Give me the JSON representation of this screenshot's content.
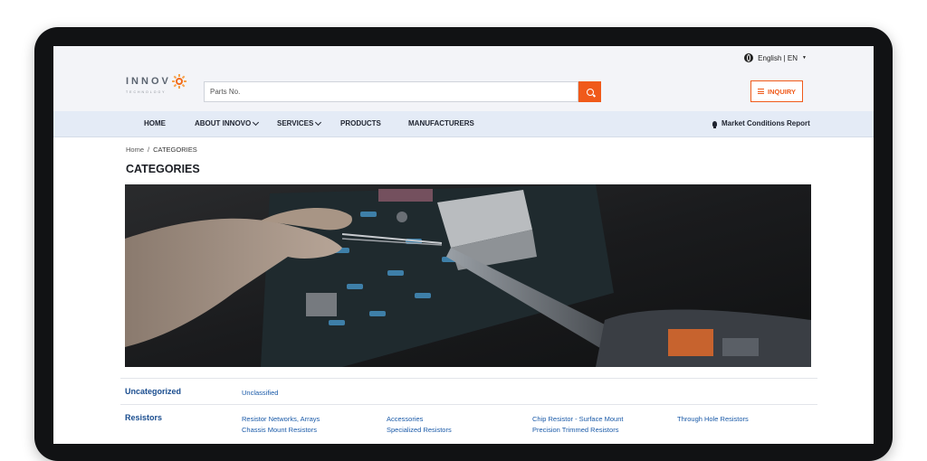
{
  "header": {
    "language_label": "English | EN",
    "logo_text": "INNOV",
    "logo_subtext": "TECHNOLOGY",
    "search_placeholder": "Parts No.",
    "inquiry_label": "INQUIRY"
  },
  "nav": {
    "items": [
      {
        "label": "HOME",
        "dropdown": false
      },
      {
        "label": "ABOUT INNOVO",
        "dropdown": true
      },
      {
        "label": "SERVICES",
        "dropdown": true
      },
      {
        "label": "PRODUCTS",
        "dropdown": false
      },
      {
        "label": "MANUFACTURERS",
        "dropdown": false
      }
    ],
    "report_label": "Market Conditions Report"
  },
  "breadcrumb": {
    "home": "Home",
    "separator": "/",
    "current": "CATEGORIES"
  },
  "page_title": "CATEGORIES",
  "hero": {
    "description_icon": "circuit-board-soldering-photo"
  },
  "categories": [
    {
      "name": "Uncategorized",
      "subcategories": [
        "Unclassified"
      ]
    },
    {
      "name": "Resistors",
      "subcategories": [
        "Resistor Networks, Arrays",
        "Accessories",
        "Chip Resistor - Surface Mount",
        "Through Hole Resistors",
        "Chassis Mount Resistors",
        "Specialized Resistors",
        "Precision Trimmed Resistors"
      ]
    }
  ],
  "colors": {
    "accent": "#f05a1a",
    "nav_bg": "#e4ebf6",
    "link": "#1a5aa8",
    "category": "#1a4d8f"
  }
}
